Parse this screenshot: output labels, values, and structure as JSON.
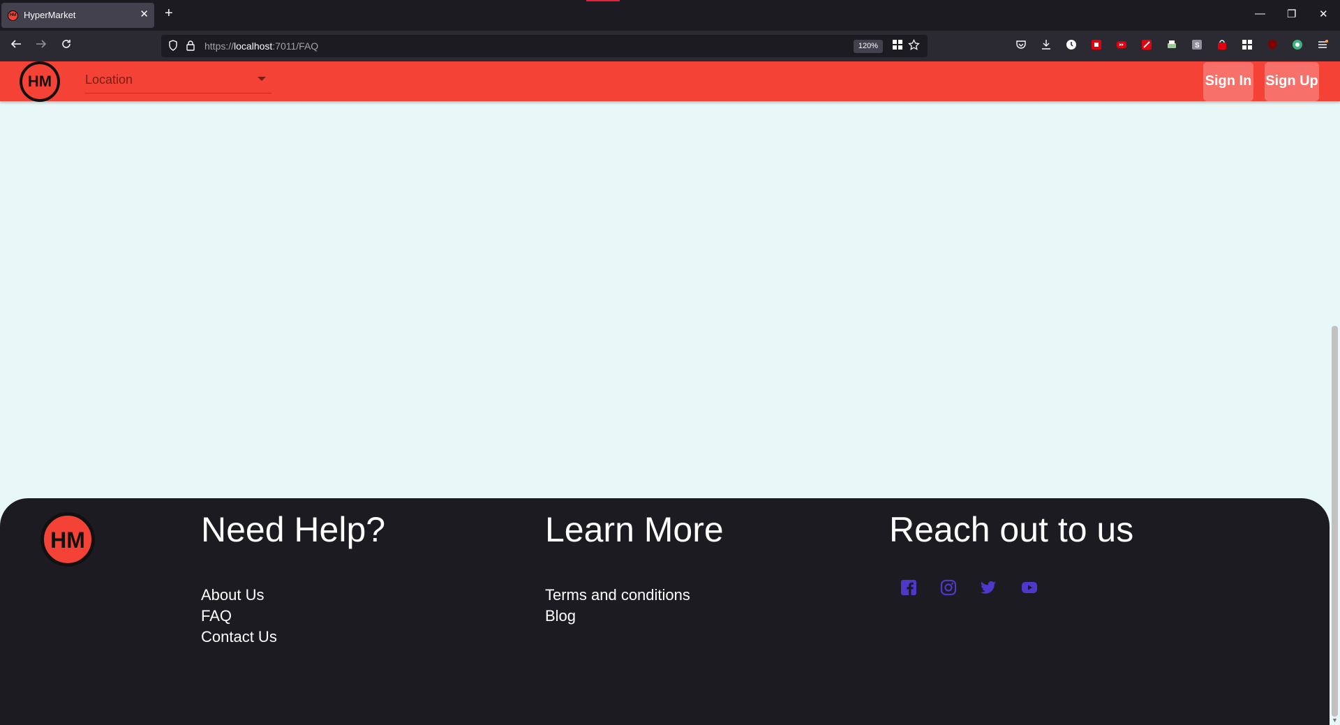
{
  "browser": {
    "tab_title": "HyperMarket",
    "tab_close": "✕",
    "new_tab": "+",
    "url_scheme": "https://",
    "url_host": "localhost",
    "url_rest": ":7011/FAQ",
    "zoom": "120%",
    "window_controls": [
      "—",
      "❐",
      "✕"
    ],
    "nav_icons": [
      "arrow-left-icon",
      "arrow-right-icon",
      "reload-icon"
    ]
  },
  "header": {
    "logo_text": "HM",
    "location_placeholder": "Location",
    "signin_label": "Sign In",
    "signup_label": "Sign Up",
    "brand_color": "#f44336"
  },
  "footer": {
    "logo_text": "HM",
    "help": {
      "heading": "Need Help?",
      "links": [
        "About Us",
        "FAQ",
        "Contact Us"
      ]
    },
    "learn": {
      "heading": "Learn More",
      "links": [
        "Terms and conditions",
        "Blog"
      ]
    },
    "reach": {
      "heading": "Reach out to us",
      "icons": [
        "facebook-icon",
        "instagram-icon",
        "twitter-icon",
        "youtube-icon"
      ]
    },
    "social_color": "#4d38c9",
    "background": "#1c1b22"
  },
  "page_background": "#e8f8f8"
}
